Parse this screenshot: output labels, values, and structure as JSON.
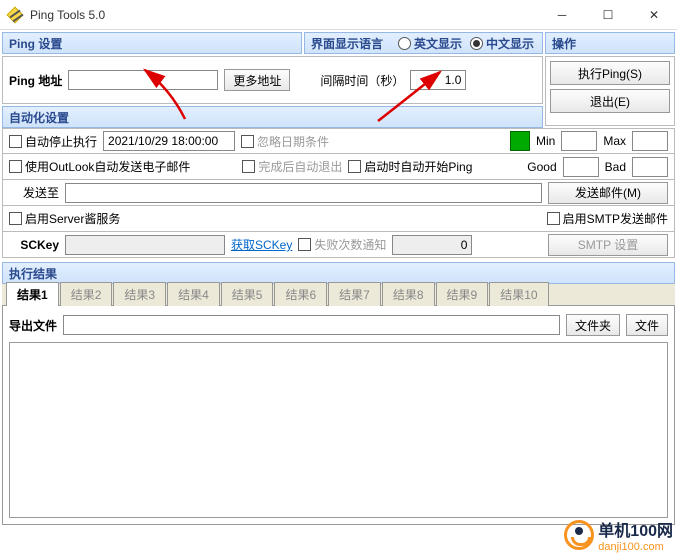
{
  "window": {
    "title": "Ping Tools 5.0"
  },
  "headers": {
    "pingset": "Ping 设置",
    "langset": "界面显示语言",
    "ops": "操作",
    "autoset": "自动化设置",
    "results": "执行结果"
  },
  "lang": {
    "en": "英文显示",
    "zh": "中文显示",
    "selected": "zh"
  },
  "ops": {
    "run": "执行Ping(S)",
    "exit": "退出(E)"
  },
  "ping": {
    "addr_label": "Ping 地址",
    "addr_value": "",
    "more": "更多地址",
    "interval_label": "间隔时间（秒）",
    "interval_value": "1.0"
  },
  "auto": {
    "autostop": "自动停止执行",
    "datetime": "2021/10/29 18:00:00",
    "ignoredate": "忽略日期条件",
    "outlook": "使用OutLook自动发送电子邮件",
    "exitafter": "完成后自动退出",
    "autostart": "启动时自动开始Ping",
    "sendto": "发送至",
    "sendmail": "发送邮件(M)",
    "serverchan": "启用Server酱服务",
    "sckey_label": "SCKey",
    "sckey_get": "获取SCKey",
    "failnotify": "失败次数通知",
    "failcount": "0",
    "smtp_enable": "启用SMTP发送邮件",
    "smtp_set": "SMTP 设置",
    "min": "Min",
    "max": "Max",
    "good": "Good",
    "bad": "Bad"
  },
  "results": {
    "tabs": [
      "结果1",
      "结果2",
      "结果3",
      "结果4",
      "结果5",
      "结果6",
      "结果7",
      "结果8",
      "结果9",
      "结果10"
    ],
    "active": 0,
    "export_label": "导出文件",
    "export_value": "",
    "folder_btn": "文件夹",
    "file_btn": "文件"
  },
  "logo": {
    "brand": "单机100网",
    "url": "danji100.com"
  }
}
